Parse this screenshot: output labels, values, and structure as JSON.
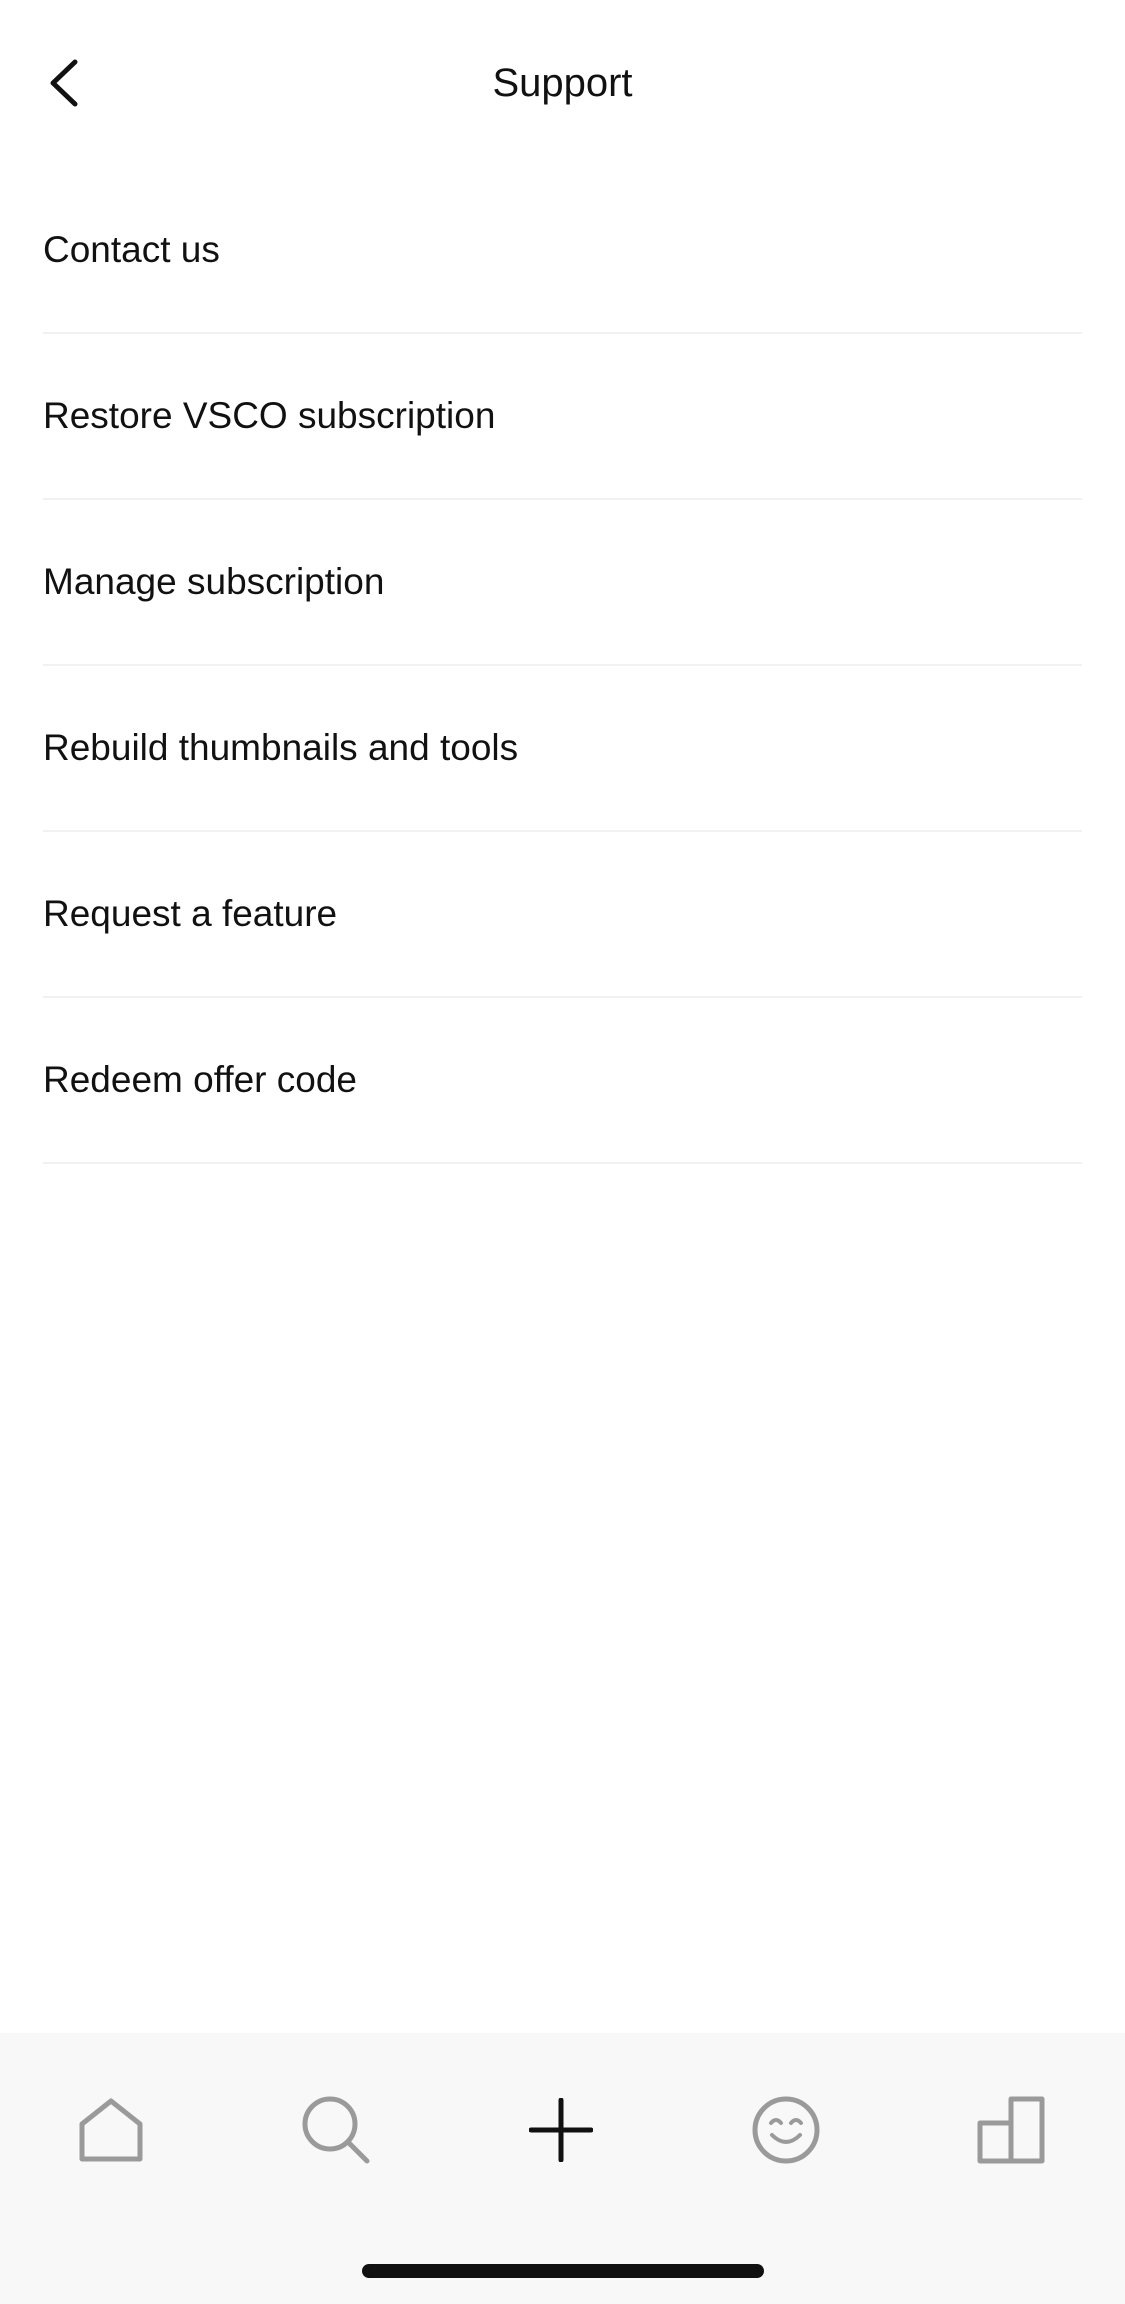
{
  "header": {
    "title": "Support",
    "back_icon": "chevron-left-icon"
  },
  "menu": {
    "items": [
      {
        "label": "Contact us"
      },
      {
        "label": "Restore VSCO subscription"
      },
      {
        "label": "Manage subscription"
      },
      {
        "label": "Rebuild thumbnails and tools"
      },
      {
        "label": "Request a feature"
      },
      {
        "label": "Redeem offer code"
      }
    ]
  },
  "tabbar": {
    "tabs": [
      {
        "icon": "home-icon"
      },
      {
        "icon": "search-icon"
      },
      {
        "icon": "plus-icon"
      },
      {
        "icon": "smiley-face-icon"
      },
      {
        "icon": "studio-icon"
      }
    ],
    "active_color": "#111111",
    "inactive_color": "#9a9a9a"
  }
}
